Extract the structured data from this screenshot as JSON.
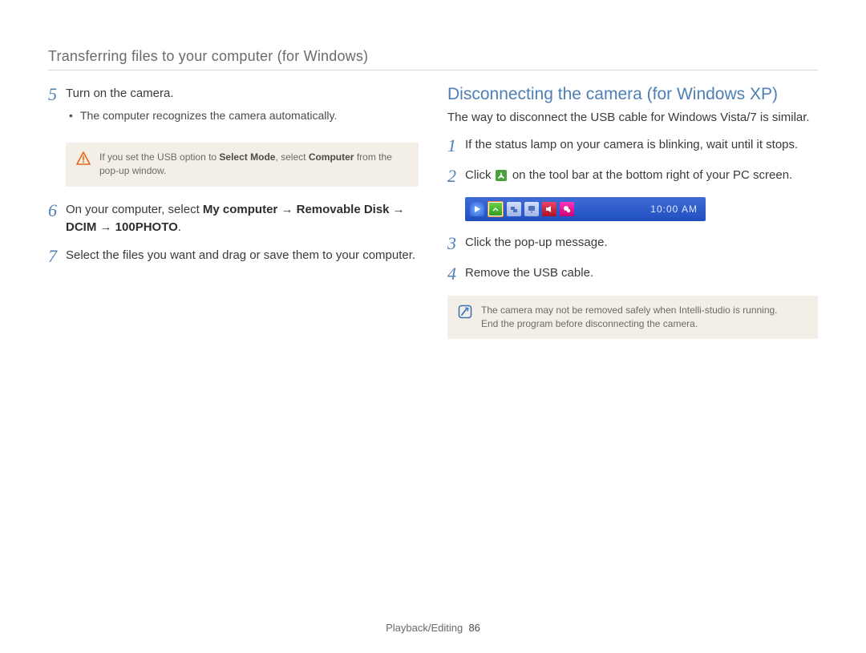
{
  "header": {
    "section_title": "Transferring files to your computer (for Windows)"
  },
  "left": {
    "steps": {
      "s5": {
        "num": "5",
        "text": "Turn on the camera.",
        "bullet": "The computer recognizes the camera automatically."
      },
      "s6": {
        "num": "6",
        "prefix": "On your computer, select ",
        "bold1": "My computer",
        "arrow": " → ",
        "bold2": "Removable Disk",
        "bold3": "DCIM",
        "bold4": "100PHOTO",
        "period": "."
      },
      "s7": {
        "num": "7",
        "text": "Select the files you want and drag or save them to your computer."
      }
    },
    "note": {
      "prefix": "If you set the USB option to ",
      "bold1": "Select Mode",
      "mid": ", select ",
      "bold2": "Computer",
      "suffix": " from the pop-up window."
    }
  },
  "right": {
    "heading": "Disconnecting the camera (for Windows XP)",
    "intro": "The way to disconnect the USB cable for Windows Vista/7 is similar.",
    "steps": {
      "s1": {
        "num": "1",
        "text": "If the status lamp on your camera is blinking, wait until it stops."
      },
      "s2": {
        "num": "2",
        "prefix": "Click ",
        "suffix": " on the tool bar at the bottom right of your PC screen."
      },
      "s3": {
        "num": "3",
        "text": "Click the pop-up message."
      },
      "s4": {
        "num": "4",
        "text": "Remove the USB cable."
      }
    },
    "taskbar": {
      "time": "10:00 AM"
    },
    "note": {
      "line1": "The camera may not be removed safely when Intelli-studio is running.",
      "line2": "End the program before disconnecting the camera."
    }
  },
  "footer": {
    "section": "Playback/Editing",
    "page": "86"
  }
}
